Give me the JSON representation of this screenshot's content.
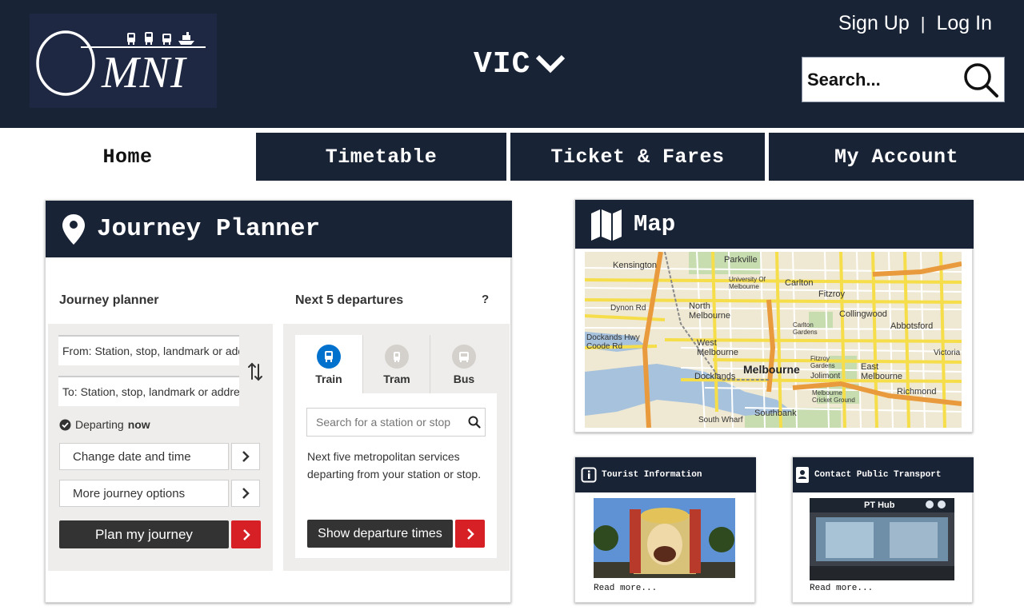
{
  "header": {
    "region": "VIC",
    "auth": {
      "sign_up": "Sign Up",
      "separator": "|",
      "log_in": "Log In"
    },
    "search": {
      "placeholder": "Search..."
    },
    "logo": {
      "text": "MNI"
    }
  },
  "nav": {
    "tabs": [
      {
        "label": "Home",
        "active": true
      },
      {
        "label": "Timetable",
        "active": false
      },
      {
        "label": "Ticket & Fares",
        "active": false
      },
      {
        "label": "My Account",
        "active": false
      }
    ]
  },
  "journey_planner": {
    "title": "Journey Planner",
    "planner": {
      "heading": "Journey planner",
      "from_placeholder": "From: Station, stop, landmark or address",
      "to_placeholder": "To: Station, stop, landmark or address",
      "departing_prefix": "Departing ",
      "departing_value": "now",
      "change_date": "Change date and time",
      "more_options": "More journey options",
      "plan_button": "Plan my journey"
    },
    "departures": {
      "heading": "Next 5 departures",
      "help": "?",
      "modes": [
        {
          "label": "Train",
          "active": true
        },
        {
          "label": "Tram",
          "active": false
        },
        {
          "label": "Bus",
          "active": false
        }
      ],
      "search_placeholder": "Search for a station or stop",
      "description": "Next five metropolitan services departing from your station or stop.",
      "show_button": "Show departure times"
    }
  },
  "map": {
    "title": "Map",
    "labels": [
      "Kensington",
      "Parkville",
      "University Of Melbourne",
      "Carlton",
      "Fitzroy",
      "North Melbourne",
      "Collingwood",
      "Abbotsford",
      "West Melbourne",
      "Melbourne",
      "East Melbourne",
      "Richmond",
      "Docklands",
      "Southbank",
      "South Wharf",
      "Dynon Rd",
      "Dockands Hwy",
      "Coode Rd",
      "Victoria",
      "Jolimont",
      "Carlton Gardens",
      "Fitzroy Gardens",
      "Melbourne Cricket Ground"
    ]
  },
  "tourist": {
    "title": "Tourist Information",
    "read_more": "Read more..."
  },
  "contact": {
    "title": "Contact Public Transport",
    "read_more": "Read more...",
    "photo_sign": "PT Hub"
  },
  "colors": {
    "navy": "#192336",
    "accent_red": "#d71f26",
    "train_blue": "#0072ce"
  }
}
